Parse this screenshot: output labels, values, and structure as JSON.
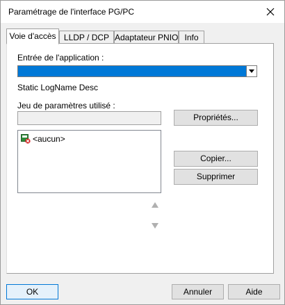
{
  "window": {
    "title": "Paramétrage de l'interface PG/PC"
  },
  "tabs": [
    {
      "label": "Voie d'accès",
      "active": true
    },
    {
      "label": "LLDP / DCP",
      "active": false
    },
    {
      "label": "Adaptateur PNIO",
      "active": false
    },
    {
      "label": "Info",
      "active": false
    }
  ],
  "access": {
    "app_entry_label": "Entrée de l'application :",
    "app_entry_value": "",
    "logname_desc": "Static LogName Desc",
    "param_set_label": "Jeu de paramètres utilisé :",
    "param_set_value": "",
    "properties_button": "Propriétés...",
    "copy_button": "Copier...",
    "delete_button": "Supprimer",
    "list_items": [
      {
        "label": "<aucun>",
        "icon": "interface-none-icon"
      }
    ]
  },
  "footer": {
    "ok": "OK",
    "cancel": "Annuler",
    "help": "Aide"
  },
  "colors": {
    "selection": "#0078d7",
    "panel": "#ffffff",
    "dialog": "#f0f0f0"
  }
}
